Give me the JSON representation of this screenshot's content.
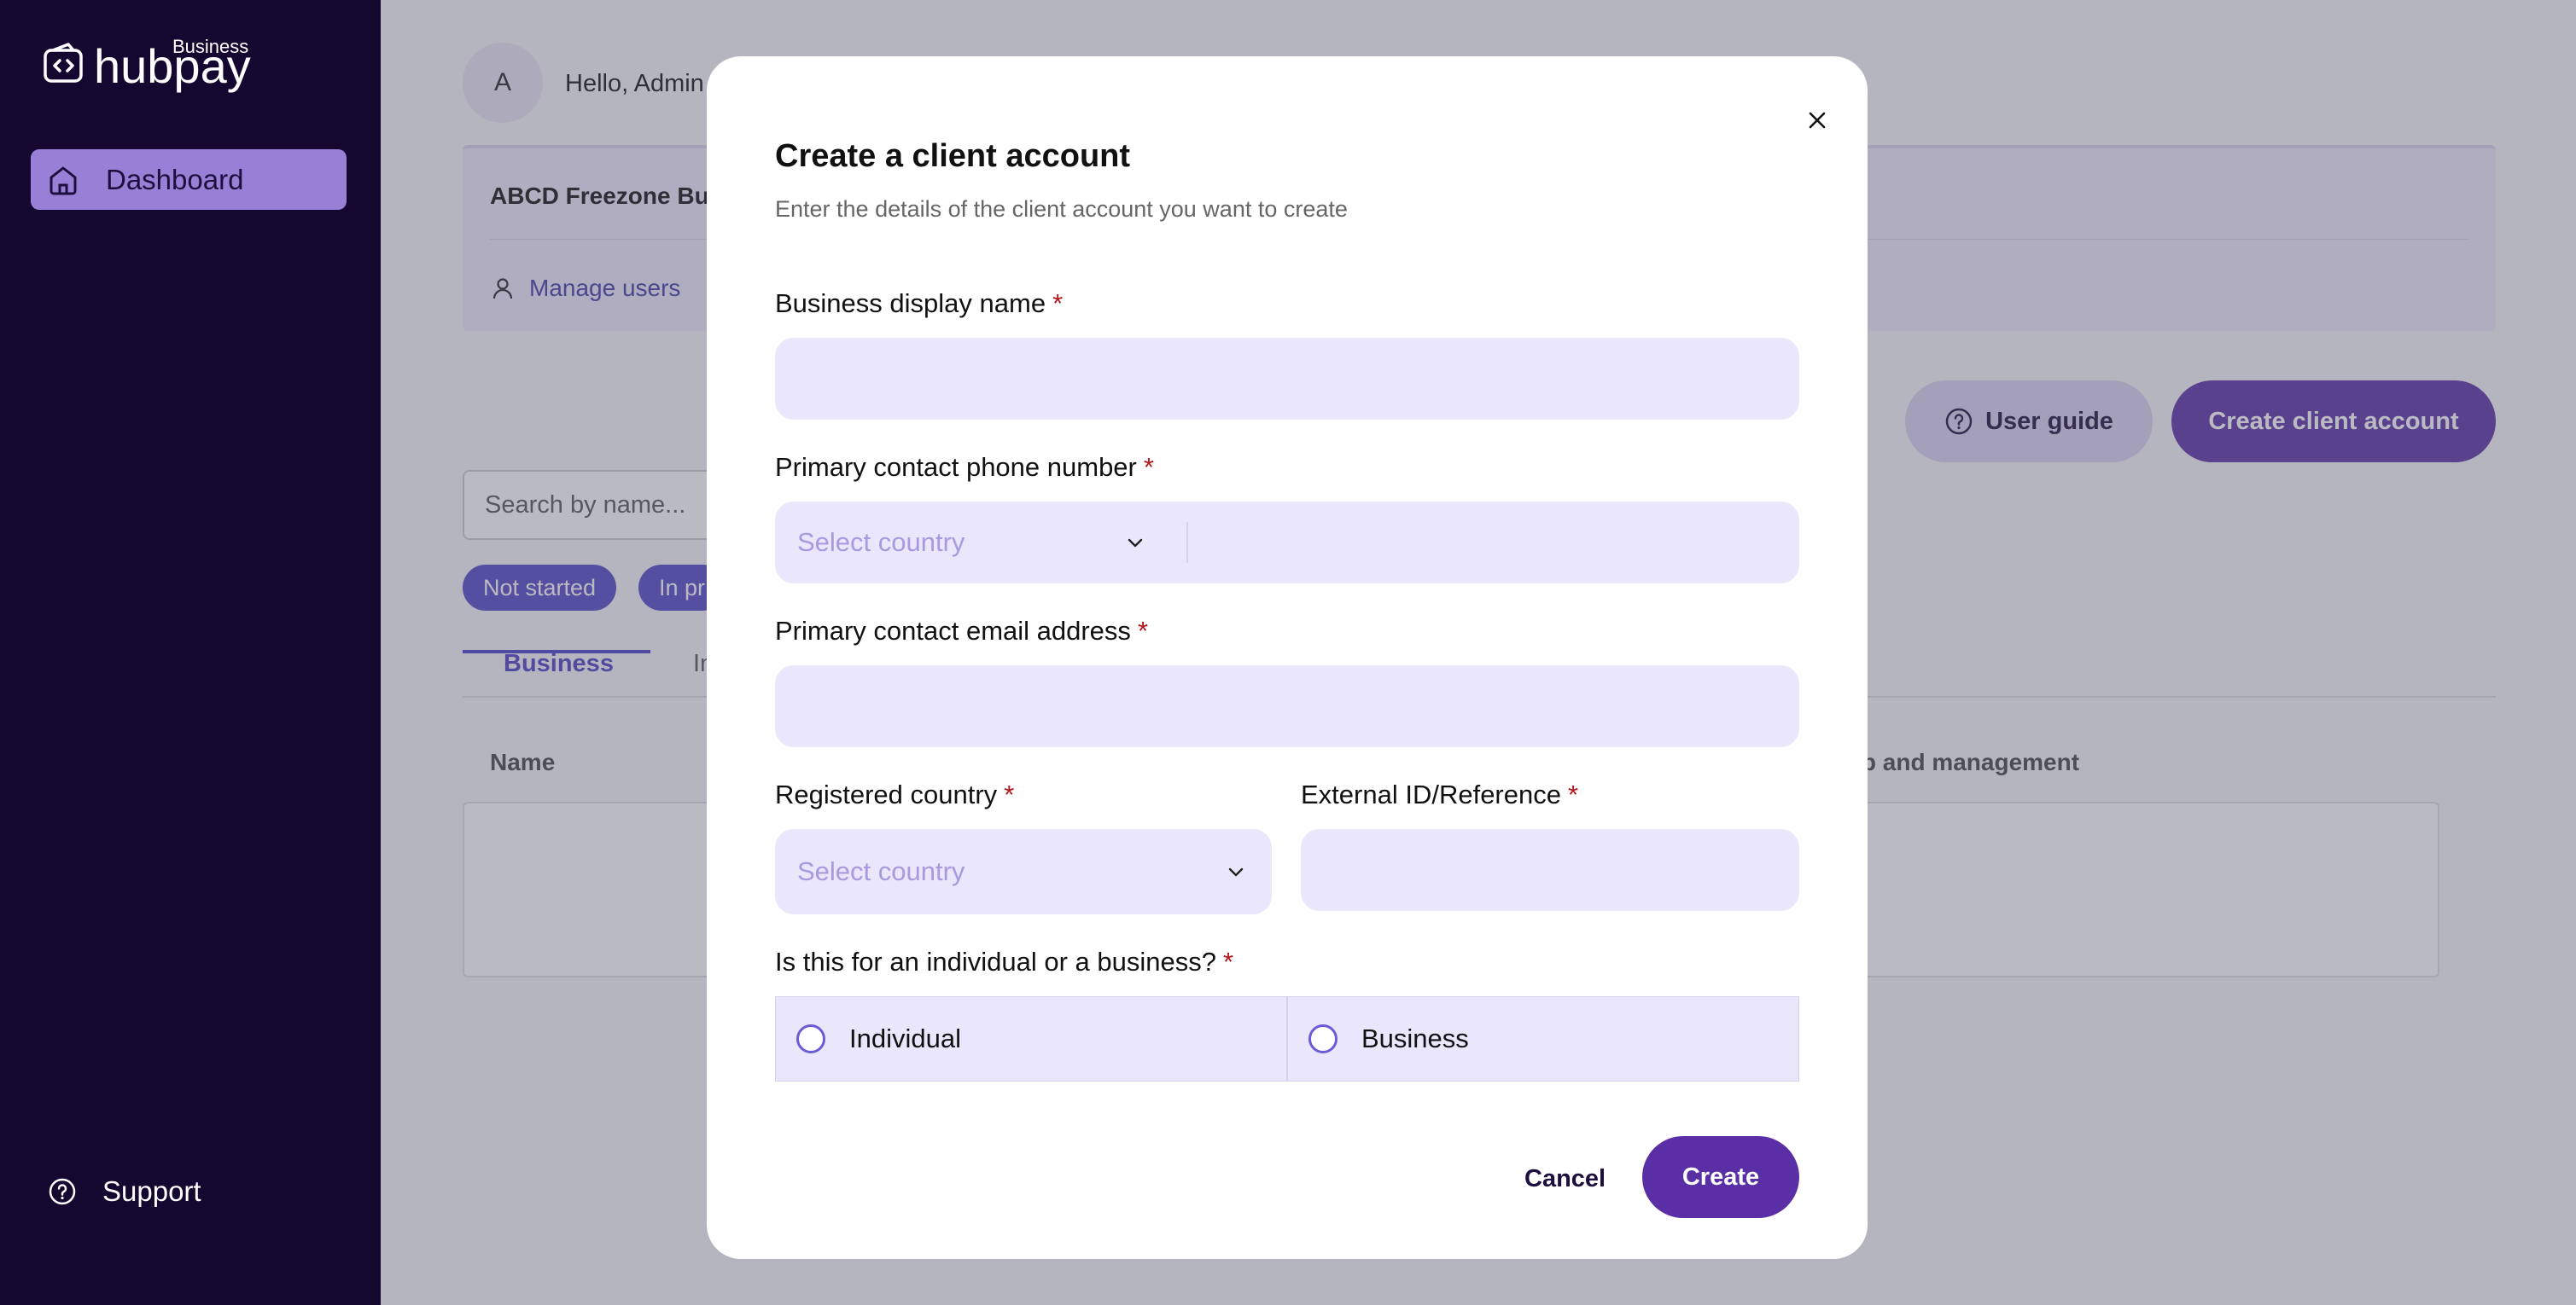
{
  "brand": {
    "name": "hubpay",
    "tag": "Business"
  },
  "sidebar": {
    "items": [
      {
        "label": "Dashboard",
        "icon": "home-icon"
      }
    ],
    "support_label": "Support"
  },
  "header": {
    "avatar_initial": "A",
    "greeting": "Hello, Admin /"
  },
  "business_card": {
    "name": "ABCD Freezone Bu",
    "manage_users_label": "Manage users"
  },
  "actions": {
    "user_guide_label": "User guide",
    "create_client_account_label": "Create client account"
  },
  "search": {
    "placeholder": "Search by name..."
  },
  "filters": {
    "chips": [
      "Not started",
      "In pr"
    ]
  },
  "tabs": {
    "items": [
      "Business",
      "In"
    ]
  },
  "table": {
    "columns": [
      "Name",
      "hip and management"
    ]
  },
  "modal": {
    "title": "Create a client account",
    "subtitle": "Enter the details of the client account you want to create",
    "fields": {
      "business_display_name": {
        "label": "Business display name",
        "value": ""
      },
      "phone": {
        "label": "Primary contact phone number",
        "country_placeholder": "Select country",
        "value": ""
      },
      "email": {
        "label": "Primary contact email address",
        "value": ""
      },
      "registered_country": {
        "label": "Registered country",
        "placeholder": "Select country"
      },
      "external_id": {
        "label": "External ID/Reference",
        "value": ""
      },
      "entity_type": {
        "label": "Is this for an individual or a business?",
        "options": [
          "Individual",
          "Business"
        ]
      }
    },
    "required_marker": "*",
    "close_icon": "close-icon",
    "cancel_label": "Cancel",
    "create_label": "Create"
  },
  "colors": {
    "sidebar_bg": "#140730",
    "primary": "#5a2fa5",
    "input_bg": "#eae6fb",
    "accent_link": "#4b3fc7",
    "required": "#b3151b"
  }
}
